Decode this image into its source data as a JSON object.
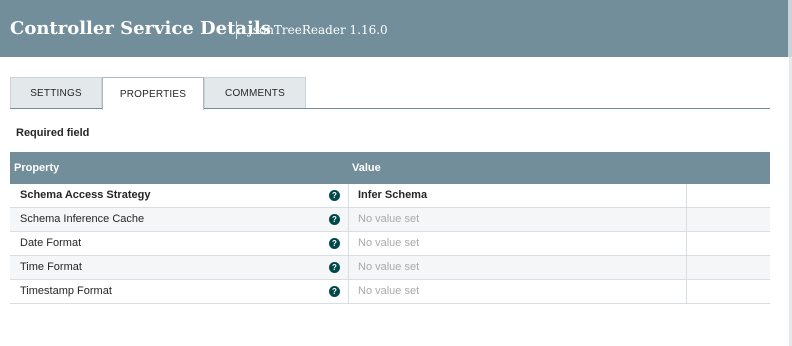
{
  "header": {
    "title": "Controller Service Details",
    "subtitle": "JsonTreeReader 1.16.0"
  },
  "tabs": [
    {
      "label": "SETTINGS",
      "active": false
    },
    {
      "label": "PROPERTIES",
      "active": true
    },
    {
      "label": "COMMENTS",
      "active": false
    }
  ],
  "required_field_label": "Required field",
  "table": {
    "headers": {
      "property": "Property",
      "value": "Value"
    },
    "rows": [
      {
        "name": "Schema Access Strategy",
        "value": "Infer Schema",
        "required": true,
        "has_help": true,
        "value_set": true
      },
      {
        "name": "Schema Inference Cache",
        "value": "No value set",
        "required": false,
        "has_help": true,
        "value_set": false
      },
      {
        "name": "Date Format",
        "value": "No value set",
        "required": false,
        "has_help": true,
        "value_set": false
      },
      {
        "name": "Time Format",
        "value": "No value set",
        "required": false,
        "has_help": true,
        "value_set": false
      },
      {
        "name": "Timestamp Format",
        "value": "No value set",
        "required": false,
        "has_help": true,
        "value_set": false
      }
    ]
  },
  "icons": {
    "help": "question-circle-icon",
    "help_glyph": "?"
  },
  "colors": {
    "header_bg": "#728e9b",
    "help_icon": "#004849"
  }
}
